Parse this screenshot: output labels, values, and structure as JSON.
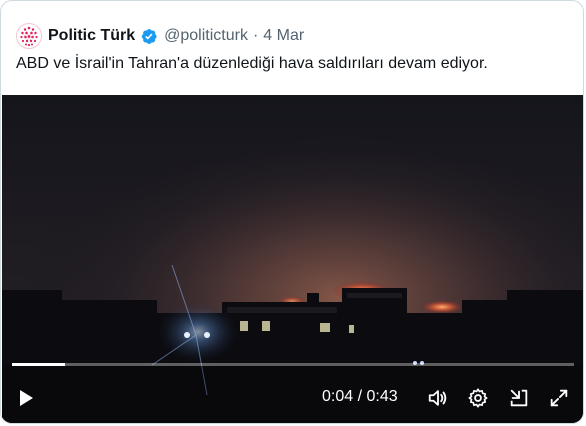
{
  "tweet": {
    "author_name": "Politic Türk",
    "handle": "@politicturk",
    "separator": "·",
    "date": "4 Mar",
    "text": "ABD ve İsrail'in Tahran'a düzenlediği hava saldırıları devam ediyor."
  },
  "video": {
    "current_time": "0:04",
    "time_separator": "/",
    "duration": "0:43",
    "progress_fraction": 0.095
  },
  "colors": {
    "verified_badge": "#1d9bf0",
    "avatar_accent": "#e0245e",
    "text_primary": "#0f1419",
    "text_secondary": "#536471"
  },
  "icons": [
    "verified-icon",
    "play-icon",
    "volume-icon",
    "settings-icon",
    "minimize-icon",
    "fullscreen-icon"
  ]
}
